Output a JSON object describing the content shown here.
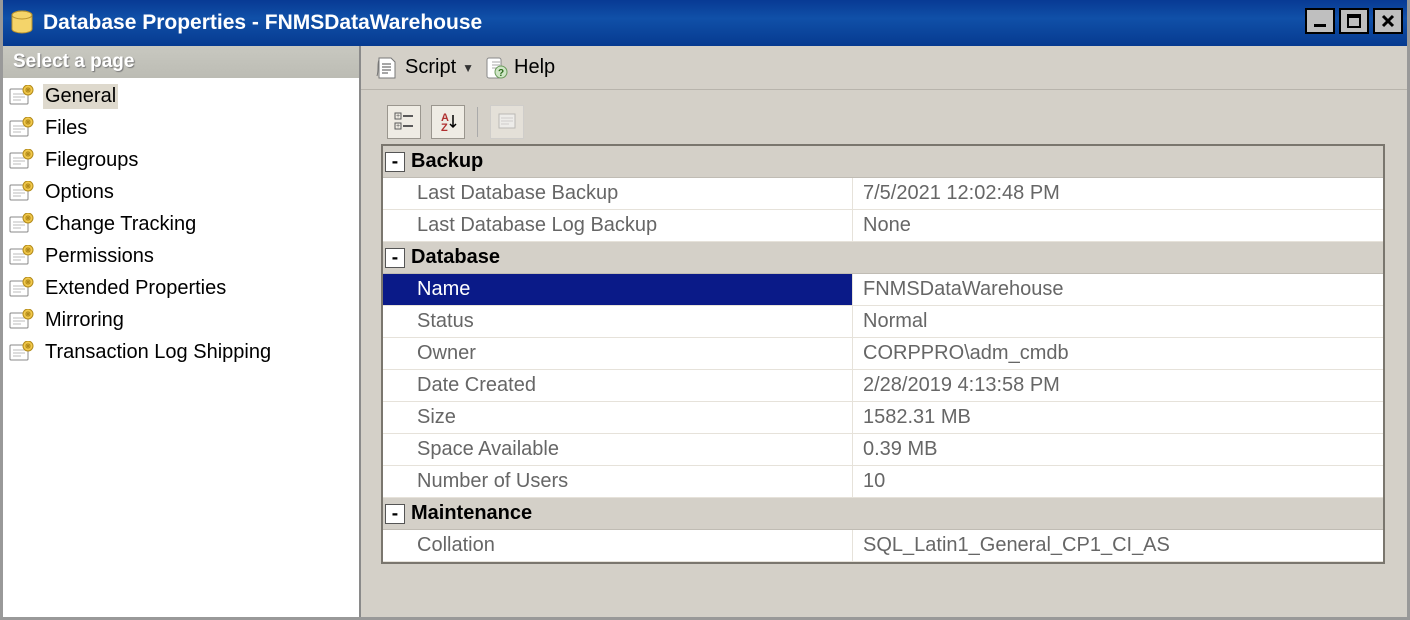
{
  "window": {
    "title": "Database Properties - FNMSDataWarehouse"
  },
  "sidebar": {
    "header": "Select a page",
    "items": [
      {
        "label": "General",
        "selected": true
      },
      {
        "label": "Files"
      },
      {
        "label": "Filegroups"
      },
      {
        "label": "Options"
      },
      {
        "label": "Change Tracking"
      },
      {
        "label": "Permissions"
      },
      {
        "label": "Extended Properties"
      },
      {
        "label": "Mirroring"
      },
      {
        "label": "Transaction Log Shipping"
      }
    ]
  },
  "toolbar": {
    "script": "Script",
    "help": "Help"
  },
  "grid_tools": {
    "categorized": "categorized-icon",
    "alpha": "alphabetical-icon",
    "pages": "property-pages-icon"
  },
  "categories": [
    {
      "name": "Backup",
      "rows": [
        {
          "label": "Last Database Backup",
          "value": "7/5/2021 12:02:48 PM"
        },
        {
          "label": "Last Database Log Backup",
          "value": "None"
        }
      ]
    },
    {
      "name": "Database",
      "rows": [
        {
          "label": "Name",
          "value": "FNMSDataWarehouse",
          "selected": true
        },
        {
          "label": "Status",
          "value": "Normal"
        },
        {
          "label": "Owner",
          "value": "CORPPRO\\adm_cmdb"
        },
        {
          "label": "Date Created",
          "value": "2/28/2019 4:13:58 PM"
        },
        {
          "label": "Size",
          "value": "1582.31 MB"
        },
        {
          "label": "Space Available",
          "value": "0.39 MB"
        },
        {
          "label": "Number of Users",
          "value": "10"
        }
      ]
    },
    {
      "name": "Maintenance",
      "rows": [
        {
          "label": "Collation",
          "value": "SQL_Latin1_General_CP1_CI_AS"
        }
      ]
    }
  ]
}
